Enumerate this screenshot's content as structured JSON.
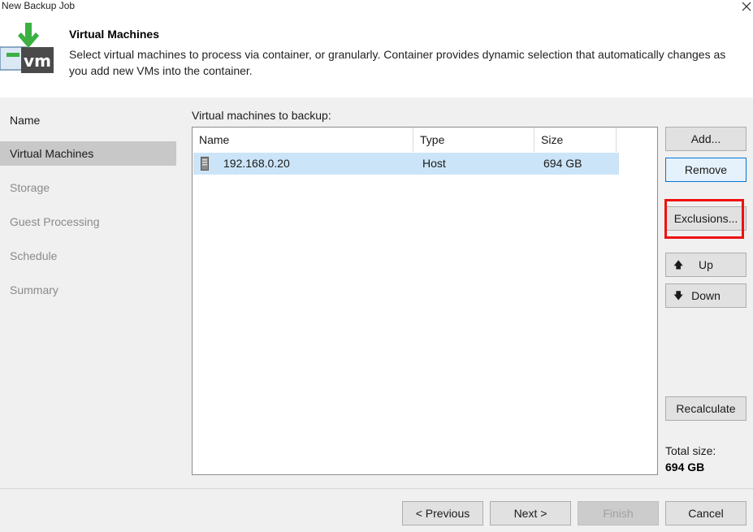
{
  "window": {
    "title": "New Backup Job"
  },
  "header": {
    "title": "Virtual Machines",
    "description": "Select virtual machines to process via container, or granularly. Container provides dynamic selection that automatically changes as you add new VMs into the container."
  },
  "sidebar": {
    "items": [
      {
        "label": "Name"
      },
      {
        "label": "Virtual Machines"
      },
      {
        "label": "Storage"
      },
      {
        "label": "Guest Processing"
      },
      {
        "label": "Schedule"
      },
      {
        "label": "Summary"
      }
    ]
  },
  "main": {
    "list_label": "Virtual machines to backup:",
    "columns": [
      "Name",
      "Type",
      "Size"
    ],
    "rows": [
      {
        "icon": "server-icon",
        "name": "192.168.0.20",
        "type": "Host",
        "size": "694 GB"
      }
    ]
  },
  "side_buttons": {
    "add": "Add...",
    "remove": "Remove",
    "exclusions": "Exclusions...",
    "up": "Up",
    "down": "Down",
    "recalculate": "Recalculate"
  },
  "total": {
    "label": "Total size:",
    "value": "694 GB"
  },
  "footer": {
    "previous": "< Previous",
    "next": "Next >",
    "finish": "Finish",
    "cancel": "Cancel"
  },
  "colors": {
    "selection": "#cce4f7",
    "highlight": "#ee1111",
    "logo_green": "#3cb043",
    "logo_dark": "#4a4a4a"
  }
}
